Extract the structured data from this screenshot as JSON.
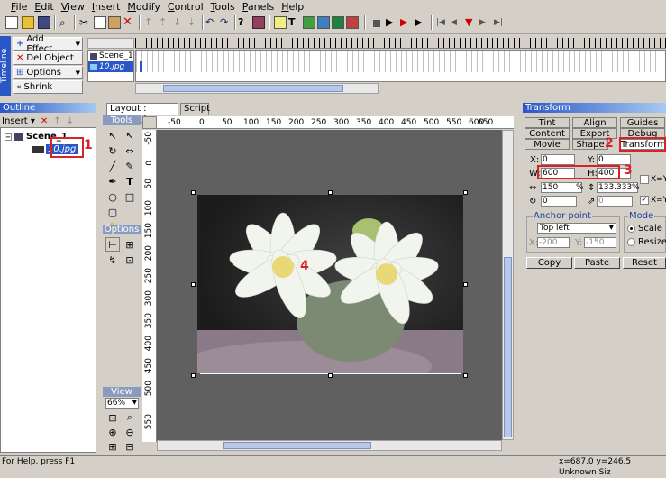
{
  "menu": [
    "File",
    "Edit",
    "View",
    "Insert",
    "Modify",
    "Control",
    "Tools",
    "Panels",
    "Help"
  ],
  "timeline": {
    "side_label": "Timeline",
    "add_effect": "Add Effect",
    "del_object": "Del Object",
    "options": "Options",
    "shrink": "Shrink",
    "layers": [
      "Scene_1",
      "10.jpg"
    ]
  },
  "outline": {
    "title": "Outline",
    "insert": "Insert",
    "scene": "Scene_1",
    "item": "10.jpg",
    "marker1": "1"
  },
  "tools": {
    "tools_label": "Tools",
    "options_label": "Options",
    "view_label": "View",
    "zoom": "66%"
  },
  "stage": {
    "tab_layout": "Layout : Scene_1",
    "tab_script": "Script",
    "ruler_x": [
      "-50",
      "0",
      "50",
      "100",
      "150",
      "200",
      "250",
      "300",
      "350",
      "400",
      "450",
      "500",
      "550",
      "600",
      "650",
      "700"
    ],
    "ruler_y": [
      "-50",
      "0",
      "50",
      "100",
      "150",
      "200",
      "250",
      "300",
      "350",
      "400",
      "450",
      "500",
      "550"
    ],
    "marker4": "4"
  },
  "transform": {
    "title": "Transform",
    "tabs_row1": [
      "Tint",
      "Align",
      "Guides"
    ],
    "tabs_row2": [
      "Content",
      "Export",
      "Debug"
    ],
    "tabs_row3": [
      "Movie",
      "Shape",
      "Transform"
    ],
    "marker2": "2",
    "marker3": "3",
    "x": "0",
    "y": "0",
    "w": "600",
    "h": "400",
    "scale_x": "150",
    "scale_y": "133.333",
    "rot": "0",
    "skew": "0",
    "xy_label": "X=Y",
    "anchor_label": "Anchor point",
    "anchor_value": "Top left",
    "anchor_x": "-200",
    "anchor_y": "-150",
    "mode_label": "Mode",
    "mode_scale": "Scale",
    "mode_resize": "Resize",
    "copy": "Copy",
    "paste": "Paste",
    "reset": "Reset"
  },
  "status": {
    "help": "For Help, press F1",
    "coords": "x=687.0 y=246.5  Unknown Siz"
  }
}
